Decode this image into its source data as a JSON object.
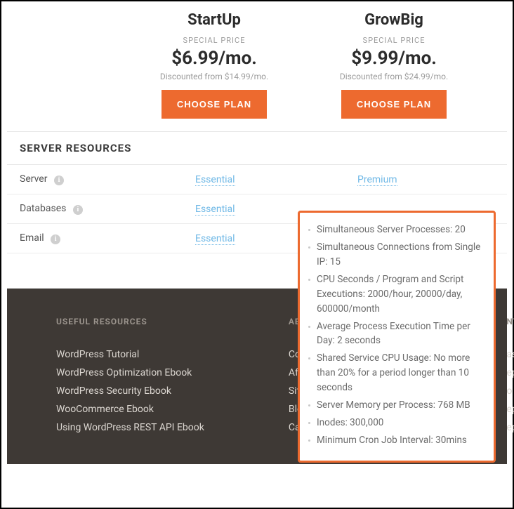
{
  "plans": [
    {
      "name": "StartUp",
      "special": "SPECIAL PRICE",
      "price": "$6.99/mo.",
      "disc": "Discounted from $14.99/mo.",
      "cta": "CHOOSE PLAN"
    },
    {
      "name": "GrowBig",
      "special": "SPECIAL PRICE",
      "price": "$9.99/mo.",
      "disc": "Discounted from $24.99/mo.",
      "cta": "CHOOSE PLAN"
    }
  ],
  "section_title": "SERVER RESOURCES",
  "rows": [
    {
      "label": "Server",
      "plan0": "Essential",
      "plan1": "Premium"
    },
    {
      "label": "Databases",
      "plan0": "Essential",
      "plan1": ""
    },
    {
      "label": "Email",
      "plan0": "Essential",
      "plan1": ""
    }
  ],
  "tooltip": [
    "Simultaneous Server Processes: 20",
    "Simultaneous Connections from Single IP: 15",
    "CPU Seconds / Program and Script Executions: 2000/hour, 20000/day, 600000/month",
    "Average Process Execution Time per Day: 2 seconds",
    "Shared Service CPU Usage: No more than 20% for a period longer than 10 seconds",
    "Server Memory per Process: 768 MB",
    "Inodes: 300,000",
    "Minimum Cron Job Interval: 30mins"
  ],
  "footer": {
    "col1": {
      "title": "USEFUL RESOURCES",
      "links": [
        "WordPress Tutorial",
        "WordPress Optimization Ebook",
        "WordPress Security Ebook",
        "WooCommerce Ebook",
        "Using WordPress REST API Ebook"
      ]
    },
    "col2": {
      "title": "ABOU",
      "links": [
        "Comp",
        "Affilia",
        "SiteG",
        "Blog",
        "Careers"
      ]
    },
    "col3": {
      "title": "NT",
      "links": [
        "ast",
        "ep",
        "o C",
        "ep",
        "ep"
      ]
    }
  }
}
